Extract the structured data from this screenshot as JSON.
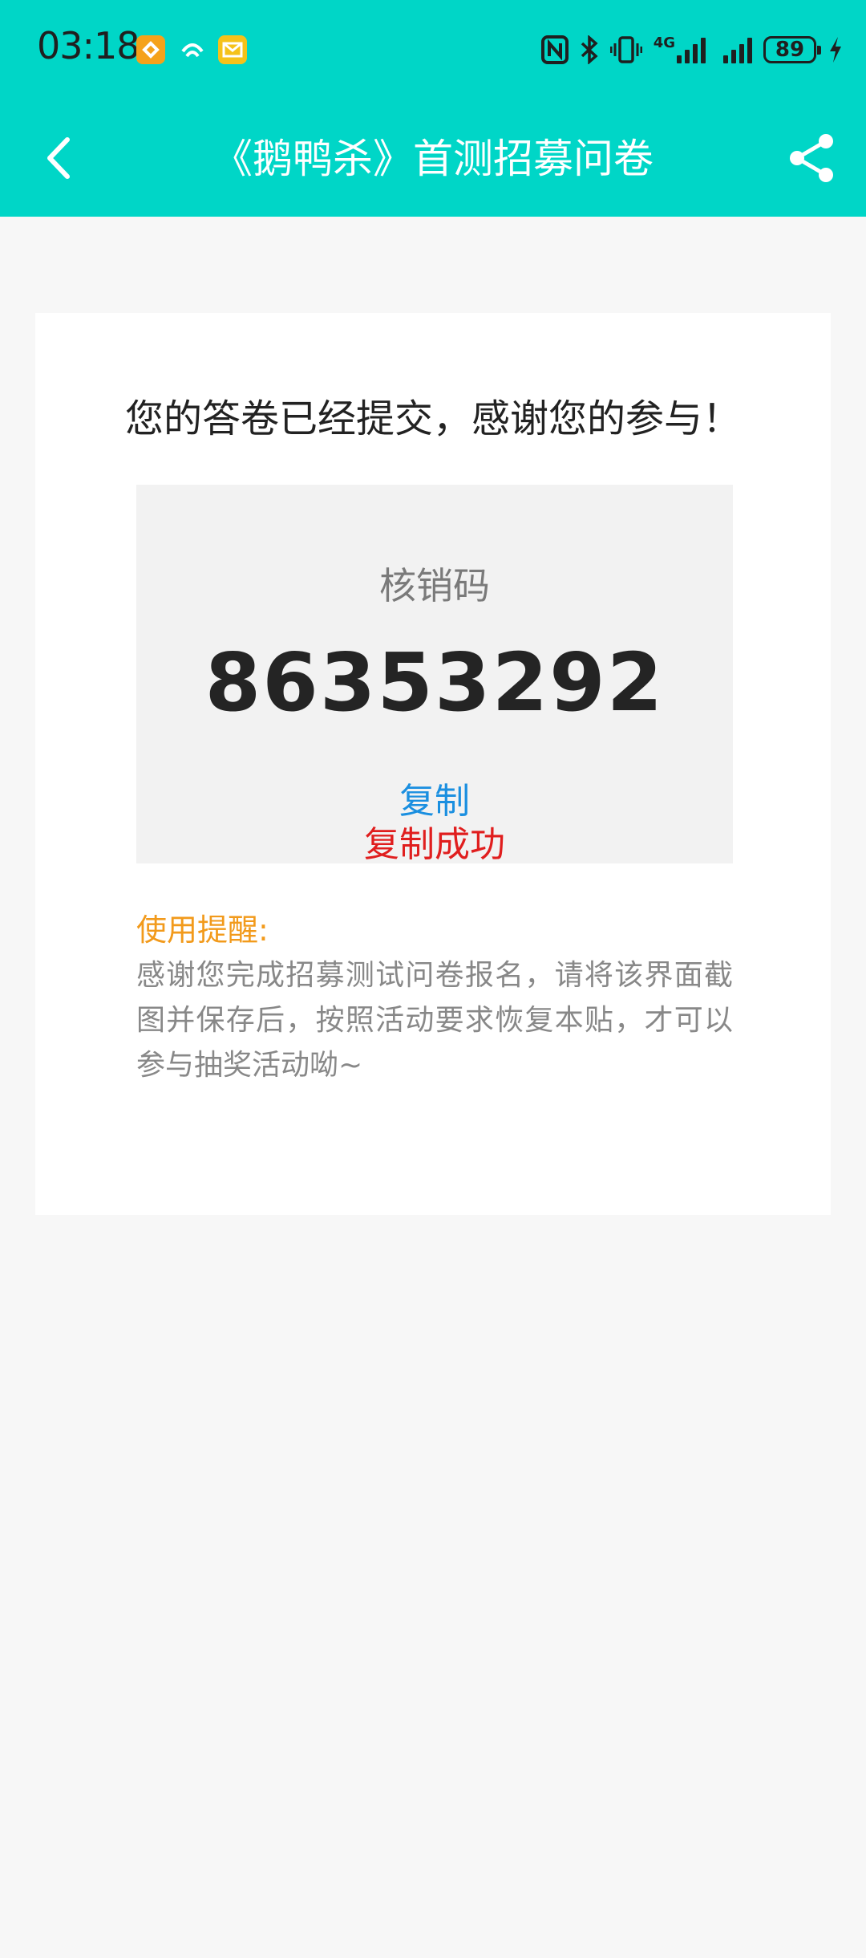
{
  "status_bar": {
    "time": "03:18",
    "network_type": "4G",
    "battery_level": "89",
    "app_icons": [
      "orange-app-icon",
      "teal-app-icon",
      "yellow-mail-icon"
    ],
    "indicator_icons": [
      "nfc-icon",
      "bluetooth-icon",
      "vibrate-icon",
      "signal-icon",
      "signal-icon",
      "battery-icon",
      "charging-icon"
    ]
  },
  "header": {
    "title": "《鹅鸭杀》首测招募问卷",
    "back_icon": "chevron-left-icon",
    "share_icon": "share-icon"
  },
  "card": {
    "submit_message": "您的答卷已经提交，感谢您的参与！",
    "code_label": "核销码",
    "code_value": "86353292",
    "copy_label": "复制",
    "copy_success": "复制成功",
    "reminder_title": "使用提醒:",
    "reminder_text": "感谢您完成招募测试问卷报名，请将该界面截图并保存后，按照活动要求恢复本贴，才可以参与抽奖活动呦~"
  },
  "colors": {
    "header_bg": "#00d6c7",
    "page_bg": "#f7f7f7",
    "code_box_bg": "#f2f2f2",
    "copy_blue": "#1a8fe0",
    "success_red": "#e01e1e",
    "reminder_orange": "#f29a1b"
  }
}
